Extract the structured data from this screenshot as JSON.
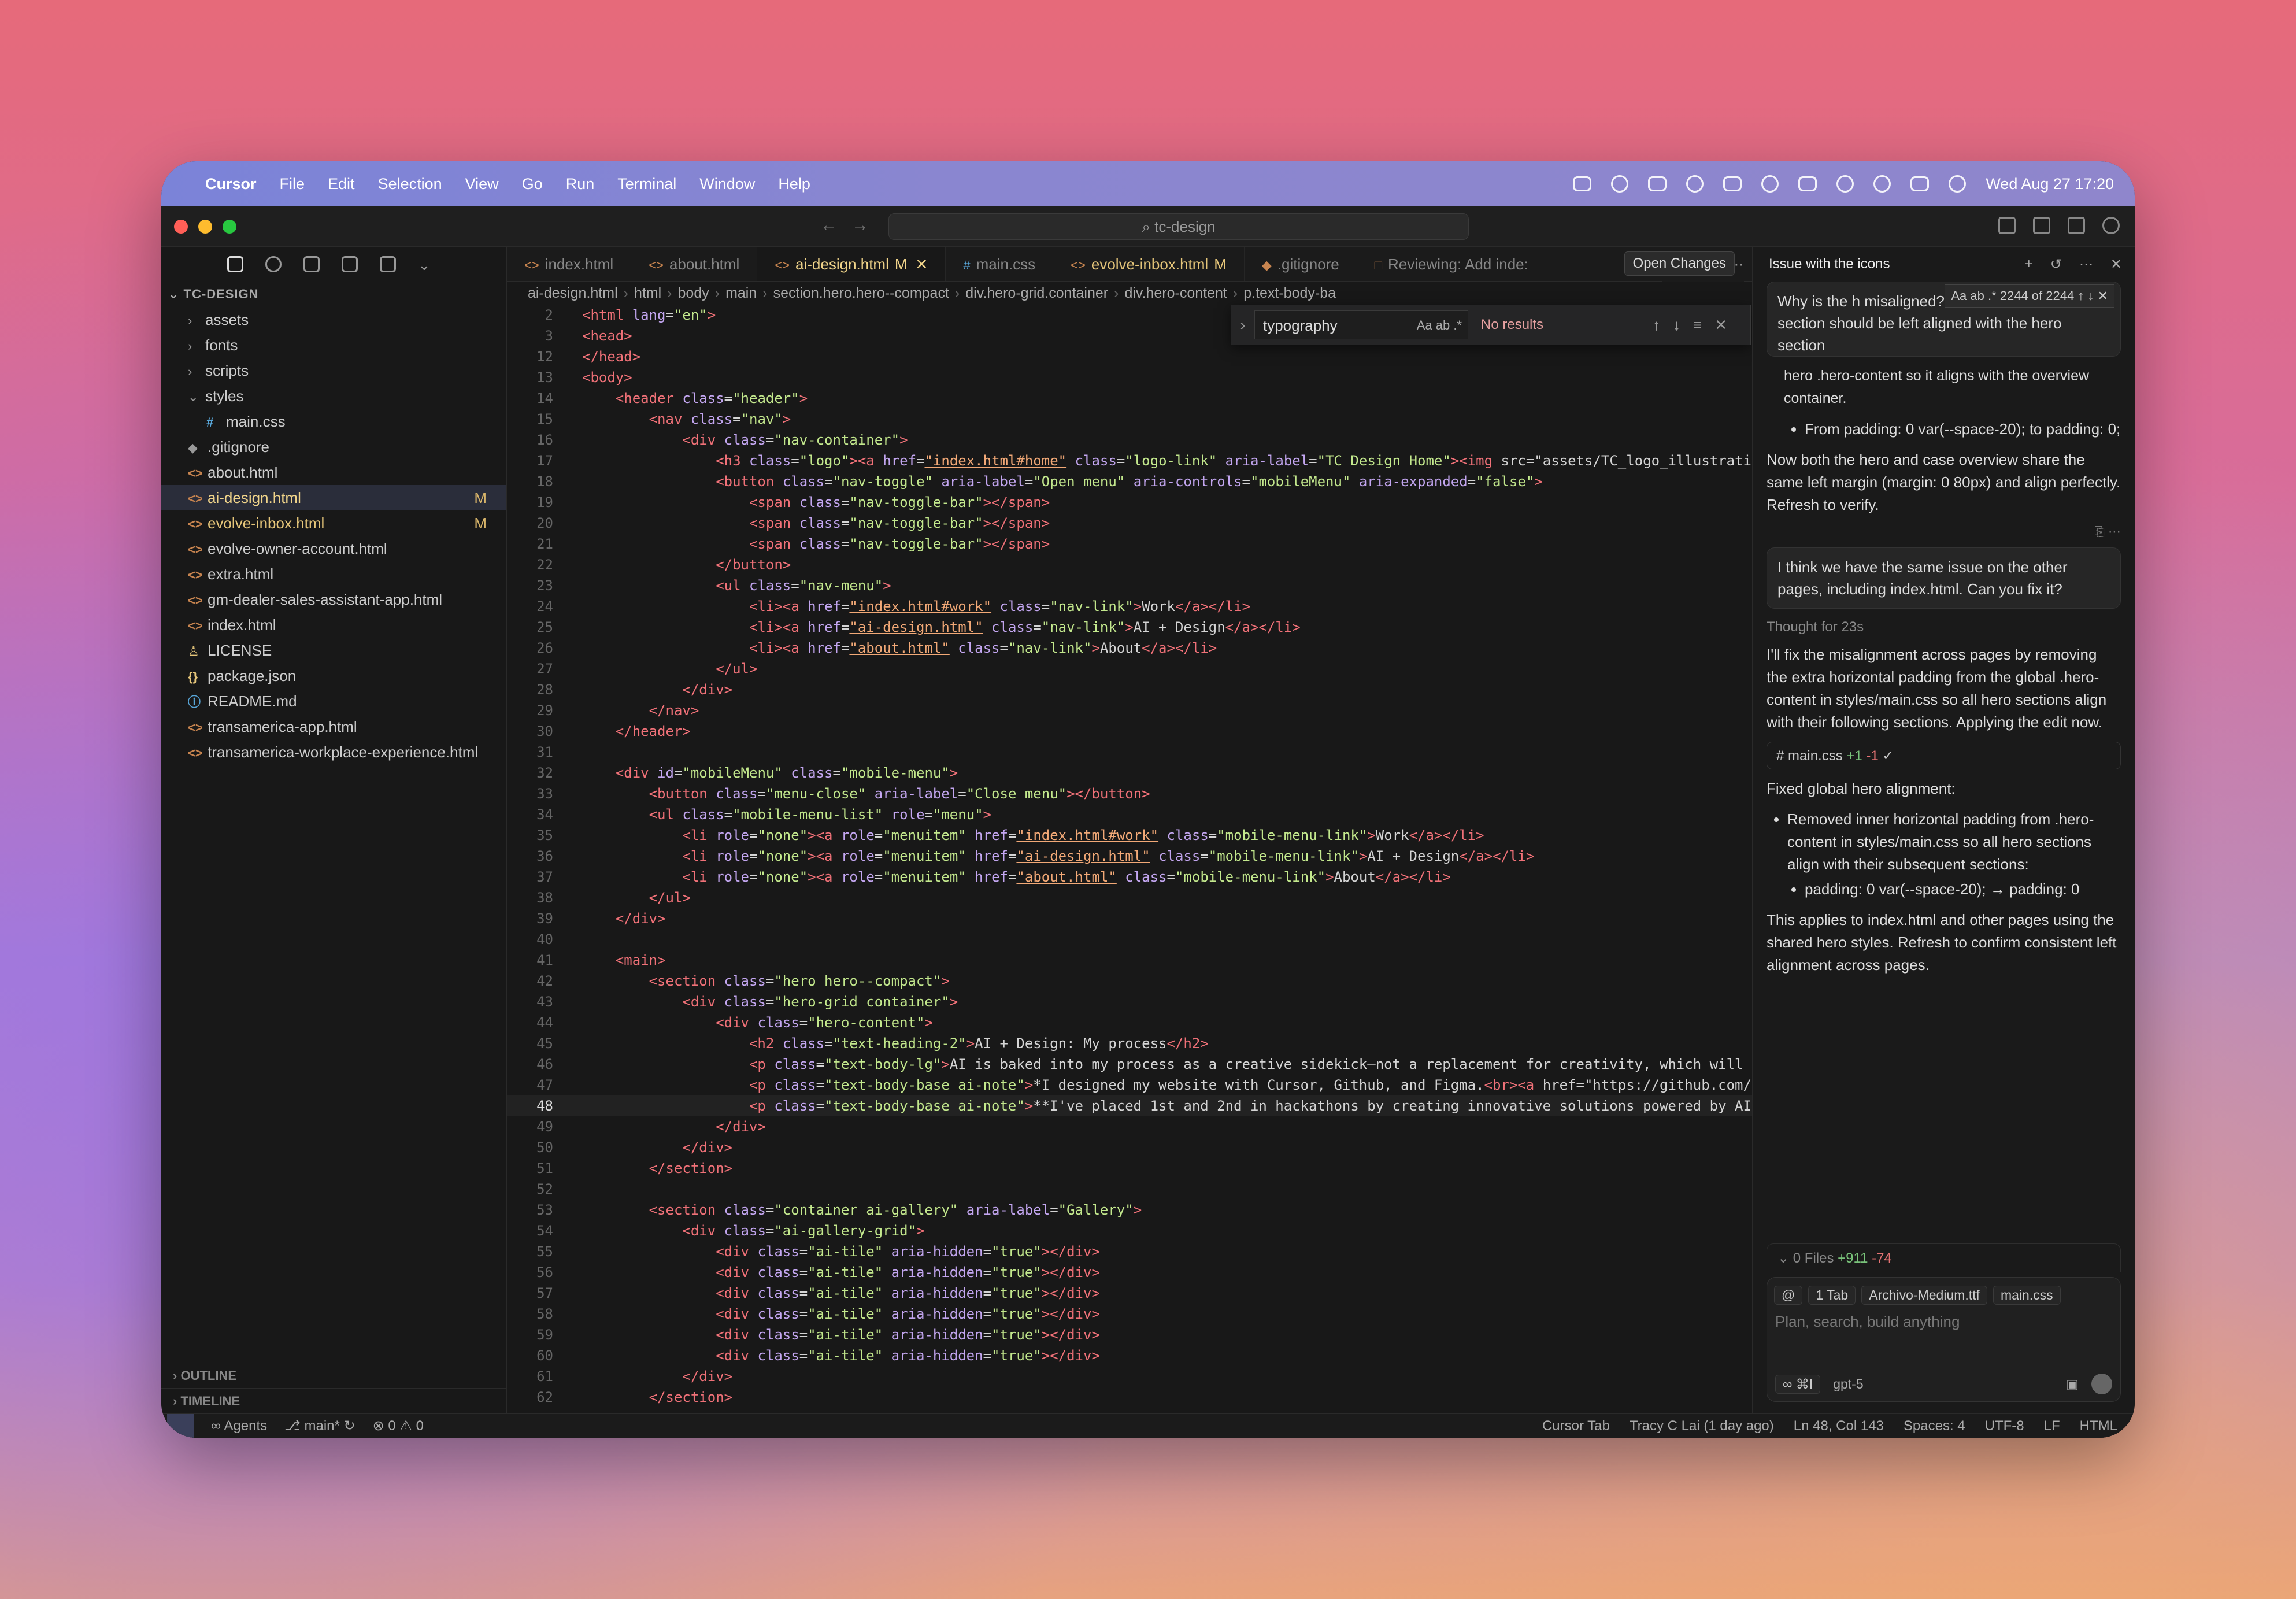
{
  "menubar": {
    "app": "Cursor",
    "items": [
      "File",
      "Edit",
      "Selection",
      "View",
      "Go",
      "Run",
      "Terminal",
      "Window",
      "Help"
    ],
    "clock": "Wed Aug 27  17:20"
  },
  "titlebar": {
    "search": "tc-design"
  },
  "sidebar": {
    "root": "TC-DESIGN",
    "items": [
      {
        "label": "assets",
        "type": "folder"
      },
      {
        "label": "fonts",
        "type": "folder"
      },
      {
        "label": "scripts",
        "type": "folder"
      },
      {
        "label": "styles",
        "type": "folder-open"
      },
      {
        "label": "main.css",
        "type": "css",
        "indent": true
      },
      {
        "label": ".gitignore",
        "type": "git"
      },
      {
        "label": "about.html",
        "type": "html"
      },
      {
        "label": "ai-design.html",
        "type": "html",
        "selected": true,
        "mark": "M"
      },
      {
        "label": "evolve-inbox.html",
        "type": "html",
        "mark": "M"
      },
      {
        "label": "evolve-owner-account.html",
        "type": "html"
      },
      {
        "label": "extra.html",
        "type": "html"
      },
      {
        "label": "gm-dealer-sales-assistant-app.html",
        "type": "html"
      },
      {
        "label": "index.html",
        "type": "html"
      },
      {
        "label": "LICENSE",
        "type": "license"
      },
      {
        "label": "package.json",
        "type": "json"
      },
      {
        "label": "README.md",
        "type": "info"
      },
      {
        "label": "transamerica-app.html",
        "type": "html"
      },
      {
        "label": "transamerica-workplace-experience.html",
        "type": "html"
      }
    ],
    "outline": "OUTLINE",
    "timeline": "TIMELINE"
  },
  "tabs": [
    {
      "label": "index.html",
      "icon": "<>"
    },
    {
      "label": "about.html",
      "icon": "<>"
    },
    {
      "label": "ai-design.html",
      "icon": "<>",
      "active": true,
      "mark": "M"
    },
    {
      "label": "main.css",
      "icon": "#"
    },
    {
      "label": "evolve-inbox.html",
      "icon": "<>",
      "mark": "M"
    },
    {
      "label": ".gitignore",
      "icon": "◆"
    },
    {
      "label": "Reviewing: Add inde:",
      "icon": "□"
    }
  ],
  "breadcrumb": [
    "ai-design.html",
    "html",
    "body",
    "main",
    "section.hero.hero--compact",
    "div.hero-grid.container",
    "div.hero-content",
    "p.text-body-ba"
  ],
  "find": {
    "query": "typography",
    "result": "No results",
    "tooltip": "Open Changes"
  },
  "code": [
    {
      "n": "2",
      "t": "<html lang=\"en\">"
    },
    {
      "n": "3",
      "t": "<head>"
    },
    {
      "n": "12",
      "t": "</head>"
    },
    {
      "n": "13",
      "t": "<body>"
    },
    {
      "n": "14",
      "t": "    <header class=\"header\">"
    },
    {
      "n": "15",
      "t": "        <nav class=\"nav\">"
    },
    {
      "n": "16",
      "t": "            <div class=\"nav-container\">"
    },
    {
      "n": "17",
      "t": "                <h3 class=\"logo\"><a href=\"index.html#home\" class=\"logo-link\" aria-label=\"TC Design Home\"><img src=\"assets/TC_logo_illustrati"
    },
    {
      "n": "18",
      "t": "                <button class=\"nav-toggle\" aria-label=\"Open menu\" aria-controls=\"mobileMenu\" aria-expanded=\"false\">"
    },
    {
      "n": "19",
      "t": "                    <span class=\"nav-toggle-bar\"></span>"
    },
    {
      "n": "20",
      "t": "                    <span class=\"nav-toggle-bar\"></span>"
    },
    {
      "n": "21",
      "t": "                    <span class=\"nav-toggle-bar\"></span>"
    },
    {
      "n": "22",
      "t": "                </button>"
    },
    {
      "n": "23",
      "t": "                <ul class=\"nav-menu\">"
    },
    {
      "n": "24",
      "t": "                    <li><a href=\"index.html#work\" class=\"nav-link\">Work</a></li>"
    },
    {
      "n": "25",
      "t": "                    <li><a href=\"ai-design.html\" class=\"nav-link\">AI + Design</a></li>"
    },
    {
      "n": "26",
      "t": "                    <li><a href=\"about.html\" class=\"nav-link\">About</a></li>"
    },
    {
      "n": "27",
      "t": "                </ul>"
    },
    {
      "n": "28",
      "t": "            </div>"
    },
    {
      "n": "29",
      "t": "        </nav>"
    },
    {
      "n": "30",
      "t": "    </header>"
    },
    {
      "n": "31",
      "t": ""
    },
    {
      "n": "32",
      "t": "    <div id=\"mobileMenu\" class=\"mobile-menu\">"
    },
    {
      "n": "33",
      "t": "        <button class=\"menu-close\" aria-label=\"Close menu\"></button>"
    },
    {
      "n": "34",
      "t": "        <ul class=\"mobile-menu-list\" role=\"menu\">"
    },
    {
      "n": "35",
      "t": "            <li role=\"none\"><a role=\"menuitem\" href=\"index.html#work\" class=\"mobile-menu-link\">Work</a></li>"
    },
    {
      "n": "36",
      "t": "            <li role=\"none\"><a role=\"menuitem\" href=\"ai-design.html\" class=\"mobile-menu-link\">AI + Design</a></li>"
    },
    {
      "n": "37",
      "t": "            <li role=\"none\"><a role=\"menuitem\" href=\"about.html\" class=\"mobile-menu-link\">About</a></li>"
    },
    {
      "n": "38",
      "t": "        </ul>"
    },
    {
      "n": "39",
      "t": "    </div>"
    },
    {
      "n": "40",
      "t": ""
    },
    {
      "n": "41",
      "t": "    <main>"
    },
    {
      "n": "42",
      "t": "        <section class=\"hero hero--compact\">"
    },
    {
      "n": "43",
      "t": "            <div class=\"hero-grid container\">"
    },
    {
      "n": "44",
      "t": "                <div class=\"hero-content\">"
    },
    {
      "n": "45",
      "t": "                    <h2 class=\"text-heading-2\">AI + Design: My process</h2>"
    },
    {
      "n": "46",
      "t": "                    <p class=\"text-body-lg\">AI is baked into my process as a creative sidekick—not a replacement for creativity, which will"
    },
    {
      "n": "47",
      "t": "                    <p class=\"text-body-base ai-note\">*I designed my website with Cursor, Github, and Figma.<br><a href=\"https://github.com/"
    },
    {
      "n": "48",
      "t": "                    <p class=\"text-body-base ai-note\">**I've placed 1st and 2nd in hackathons by creating innovative solutions powered by AI",
      "cur": true
    },
    {
      "n": "49",
      "t": "                </div>"
    },
    {
      "n": "50",
      "t": "            </div>"
    },
    {
      "n": "51",
      "t": "        </section>"
    },
    {
      "n": "52",
      "t": ""
    },
    {
      "n": "53",
      "t": "        <section class=\"container ai-gallery\" aria-label=\"Gallery\">"
    },
    {
      "n": "54",
      "t": "            <div class=\"ai-gallery-grid\">"
    },
    {
      "n": "55",
      "t": "                <div class=\"ai-tile\" aria-hidden=\"true\"></div>"
    },
    {
      "n": "56",
      "t": "                <div class=\"ai-tile\" aria-hidden=\"true\"></div>"
    },
    {
      "n": "57",
      "t": "                <div class=\"ai-tile\" aria-hidden=\"true\"></div>"
    },
    {
      "n": "58",
      "t": "                <div class=\"ai-tile\" aria-hidden=\"true\"></div>"
    },
    {
      "n": "59",
      "t": "                <div class=\"ai-tile\" aria-hidden=\"true\"></div>"
    },
    {
      "n": "60",
      "t": "                <div class=\"ai-tile\" aria-hidden=\"true\"></div>"
    },
    {
      "n": "61",
      "t": "            </div>"
    },
    {
      "n": "62",
      "t": "        </section>"
    }
  ],
  "chat": {
    "title": "Issue with the icons",
    "top_bubble": "Why is the h          misaligned? The case overview section should be left aligned with the hero section",
    "chat_find_count": "2244 of 2244",
    "prev_fragment": "hero .hero-content so it aligns with the overview container.",
    "prev_bullet": "From padding: 0 var(--space-20); to padding: 0;",
    "prev_summary": "Now both the hero and case overview share the same left margin (margin: 0 80px) and align perfectly. Refresh to verify.",
    "user_msg": "I think we have the same issue on the other pages, including index.html. Can you fix it?",
    "thought_label": "Thought",
    "thought_time": "for 23s",
    "reply1": "I'll fix the misalignment across pages by removing the extra horizontal padding from the global .hero-content in styles/main.css so all hero sections align with their following sections. Applying the edit now.",
    "file_chip": "main.css",
    "file_plus": "+1",
    "file_minus": "-1",
    "fixed_title": "Fixed global hero alignment:",
    "bullet1": "Removed inner horizontal padding from .hero-content in styles/main.css so all hero sections align with their subsequent sections:",
    "bullet1_sub": "padding: 0 var(--space-20); → padding: 0",
    "reply2": "This applies to index.html and other pages using the shared hero styles. Refresh to confirm consistent left alignment across pages.",
    "files_bar": "0 Files",
    "files_plus": "+911",
    "files_minus": "-74",
    "composer_chips": [
      "@",
      "1 Tab",
      "Archivo-Medium.ttf",
      "main.css"
    ],
    "composer_placeholder": "Plan, search, build anything",
    "agent_mode": "∞ ⌘I",
    "model": "gpt-5"
  },
  "statusbar": {
    "agents": "Agents",
    "branch": "main*",
    "problems": "⊗ 0 ⚠ 0",
    "cursor_tab": "Cursor Tab",
    "blame": "Tracy C Lai (1 day ago)",
    "position": "Ln 48, Col 143",
    "spaces": "Spaces: 4",
    "encoding": "UTF-8",
    "eol": "LF",
    "language": "HTML"
  },
  "colors": {
    "accent": "#f0d48a",
    "tag": "#f07178",
    "attr": "#c3a6f0",
    "string": "#c3e88d"
  }
}
